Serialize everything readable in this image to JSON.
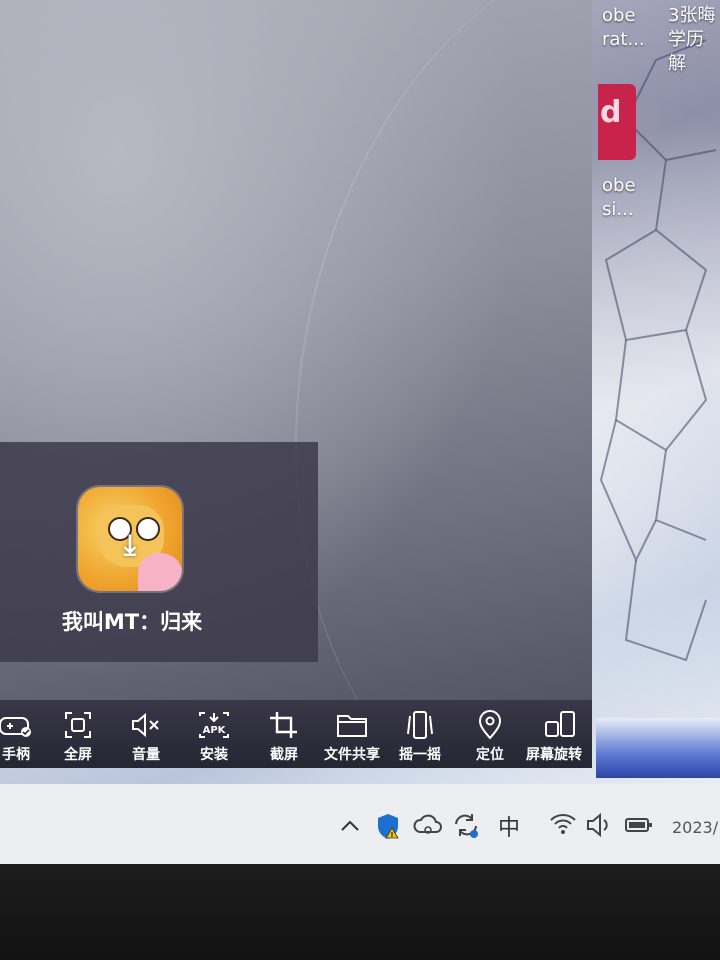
{
  "desktop": {
    "icons": [
      {
        "line1": "obe",
        "line2": "rat..."
      },
      {
        "line1": "obe",
        "line2": "si..."
      }
    ],
    "doc_icon": {
      "line1": "3张晦",
      "line2": "学历解"
    },
    "id_tile_letter": "d"
  },
  "app": {
    "name": "我叫MT：归来"
  },
  "toolbar": {
    "items": [
      {
        "label": "手柄",
        "icon": "gamepad-icon"
      },
      {
        "label": "全屏",
        "icon": "fullscreen-icon"
      },
      {
        "label": "音量",
        "icon": "volume-mute-icon"
      },
      {
        "label": "安装",
        "icon": "apk-install-icon"
      },
      {
        "label": "截屏",
        "icon": "crop-icon"
      },
      {
        "label": "文件共享",
        "icon": "folder-icon"
      },
      {
        "label": "摇一摇",
        "icon": "shake-icon"
      },
      {
        "label": "定位",
        "icon": "location-pin-icon"
      },
      {
        "label": "屏幕旋转",
        "icon": "rotate-screen-icon"
      }
    ]
  },
  "tray": {
    "ime": "中",
    "clock": "2023/"
  }
}
